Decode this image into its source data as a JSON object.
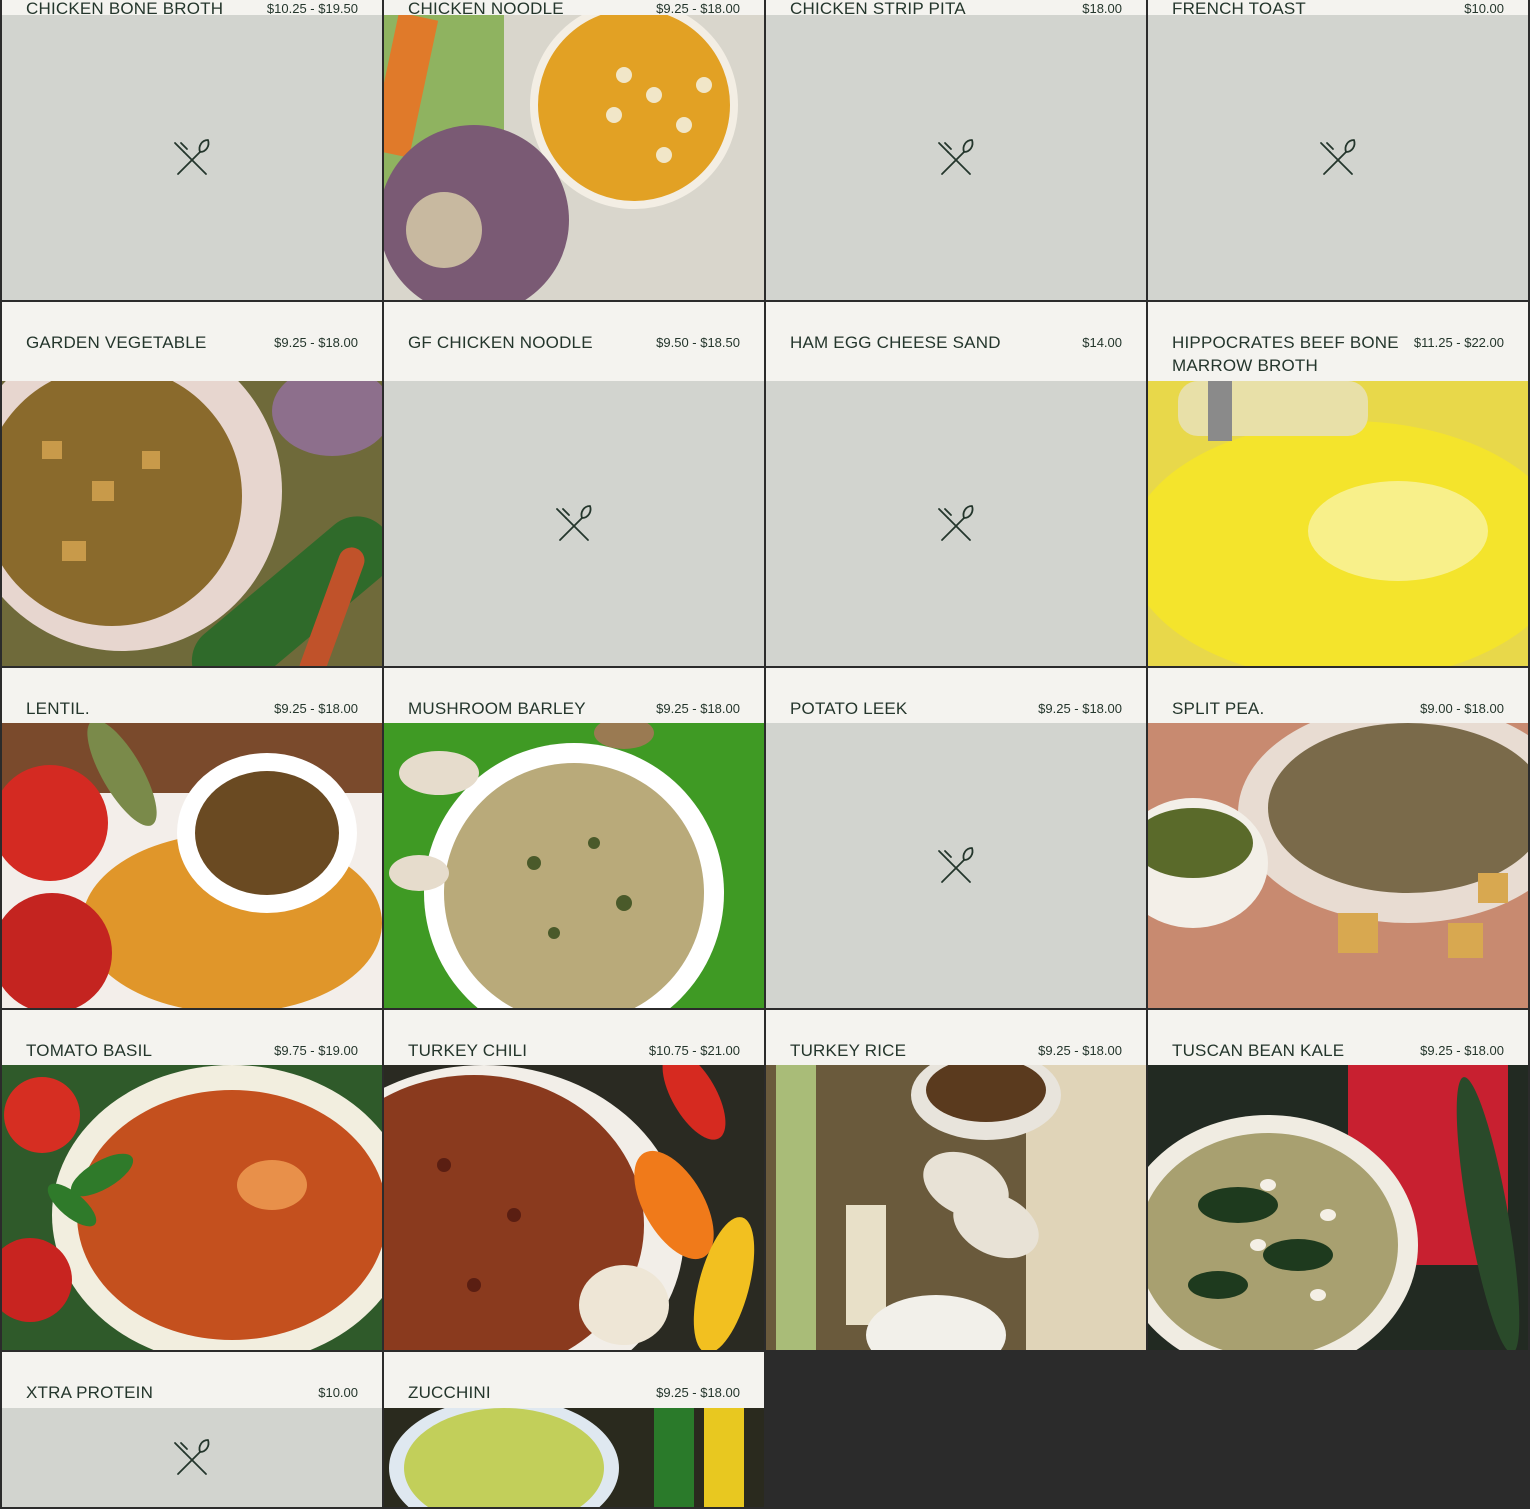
{
  "menu_items": [
    {
      "name": "CHICKEN BONE BROTH",
      "price": "$10.25 - $19.50",
      "image": "none"
    },
    {
      "name": "CHICKEN NOODLE",
      "price": "$9.25 - $18.00",
      "image": "chicken-noodle-soup-photo"
    },
    {
      "name": "CHICKEN STRIP PITA",
      "price": "$18.00",
      "image": "none"
    },
    {
      "name": "FRENCH TOAST",
      "price": "$10.00",
      "image": "none"
    },
    {
      "name": "GARDEN VEGETABLE",
      "price": "$9.25 - $18.00",
      "image": "garden-vegetable-soup-photo"
    },
    {
      "name": "GF CHICKEN NOODLE",
      "price": "$9.50 - $18.50",
      "image": "none"
    },
    {
      "name": "HAM EGG CHEESE SAND",
      "price": "$14.00",
      "image": "none"
    },
    {
      "name": "HIPPOCRATES BEEF BONE MARROW BROTH",
      "price": "$11.25 - $22.00",
      "image": "bone-marrow-broth-photo"
    },
    {
      "name": "LENTIL.",
      "price": "$9.25 - $18.00",
      "image": "lentil-soup-photo"
    },
    {
      "name": "MUSHROOM BARLEY",
      "price": "$9.25 - $18.00",
      "image": "mushroom-barley-soup-photo"
    },
    {
      "name": "POTATO LEEK",
      "price": "$9.25 - $18.00",
      "image": "none"
    },
    {
      "name": "SPLIT PEA.",
      "price": "$9.00 - $18.00",
      "image": "split-pea-soup-photo"
    },
    {
      "name": "TOMATO BASIL",
      "price": "$9.75 - $19.00",
      "image": "tomato-basil-soup-photo"
    },
    {
      "name": "TURKEY CHILI",
      "price": "$10.75 - $21.00",
      "image": "turkey-chili-photo"
    },
    {
      "name": "TURKEY RICE",
      "price": "$9.25 - $18.00",
      "image": "turkey-rice-soup-photo"
    },
    {
      "name": "TUSCAN BEAN KALE",
      "price": "$9.25 - $18.00",
      "image": "tuscan-bean-kale-soup-photo"
    },
    {
      "name": "XTRA PROTEIN",
      "price": "$10.00",
      "image": "none"
    },
    {
      "name": "ZUCCHINI",
      "price": "$9.25 - $18.00",
      "image": "zucchini-soup-photo"
    }
  ],
  "placeholder_icon": "fork-knife-icon",
  "colors": {
    "card_background": "#f4f3ef",
    "placeholder_background": "#d2d4cf",
    "text": "#24362c",
    "divider": "#2b2b2b"
  }
}
